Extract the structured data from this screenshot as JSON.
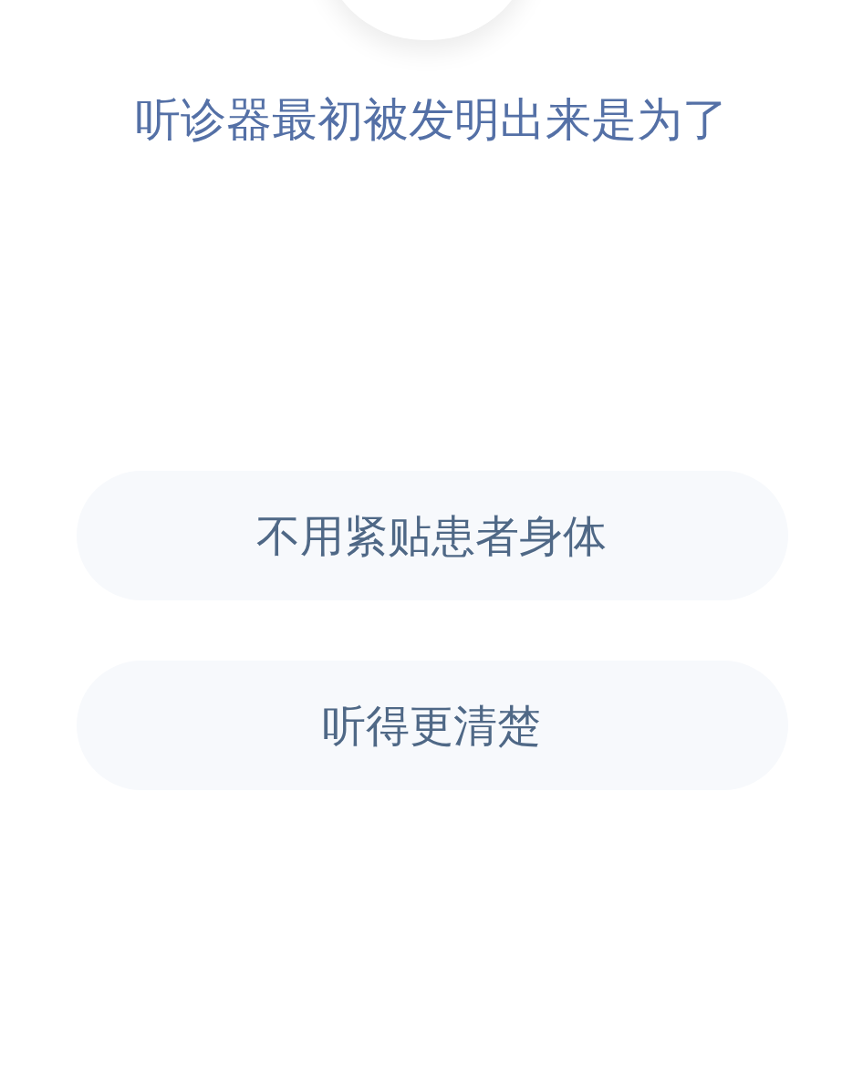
{
  "question": "听诊器最初被发明出来是为了",
  "options": [
    {
      "label": "不用紧贴患者身体"
    },
    {
      "label": "听得更清楚"
    }
  ]
}
